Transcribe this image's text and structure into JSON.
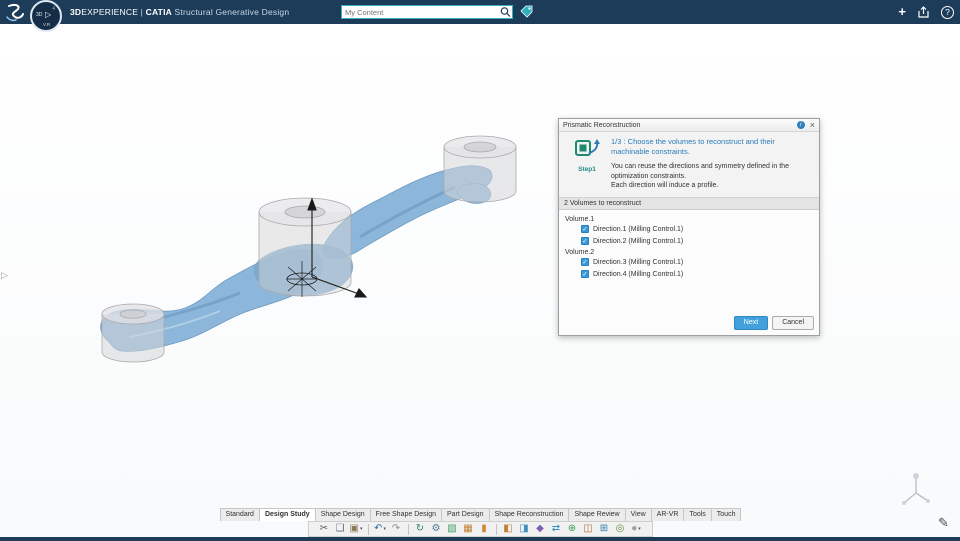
{
  "header": {
    "brand_bold": "3D",
    "brand_rest": "EXPERIENCE",
    "separator": "|",
    "app_bold": "CATIA",
    "app_rest": " Structural Generative Design",
    "search": {
      "placeholder": "My Content"
    },
    "compass": {
      "left": "3D",
      "play": "▷",
      "quad": "4",
      "bottom": "V.R"
    },
    "actions": {
      "add": "+",
      "help": "?"
    }
  },
  "viewport": {
    "panel_chevron": "▷",
    "pencil_glyph": "✎"
  },
  "dialog": {
    "title": "Prismatic Reconstruction",
    "info_glyph": "i",
    "close_glyph": "×",
    "step_label": "Step1",
    "step_text": "1/3 : Choose the volumes to reconstruct and their machinable constraints.",
    "body_line1": "You can reuse the directions and symmetry defined in the optimization constraints.",
    "body_line2": "Each direction will induce a profile.",
    "section": "2 Volumes to reconstruct",
    "volumes": [
      {
        "name": "Volume.1",
        "directions": [
          "Direction.1 (Milling Control.1)",
          "Direction.2 (Milling Control.1)"
        ]
      },
      {
        "name": "Volume.2",
        "directions": [
          "Direction.3 (Milling Control.1)",
          "Direction.4 (Milling Control.1)"
        ]
      }
    ],
    "next_label": "Next",
    "cancel_label": "Cancel",
    "accent_color": "#42a0dc",
    "checkbox_color": "#3a99d8"
  },
  "tabs": {
    "items": [
      "Standard",
      "Design Study",
      "Shape Design",
      "Free Shape Design",
      "Part Design",
      "Shape Reconstruction",
      "Shape Review",
      "View",
      "AR-VR",
      "Tools",
      "Touch"
    ],
    "active": "Design Study"
  },
  "toolbar": {
    "groups": [
      {
        "items": [
          {
            "name": "cut-icon",
            "glyph": "✂",
            "color": "#5a5a5a"
          },
          {
            "name": "copy-icon",
            "glyph": "❏",
            "color": "#5a6b7a"
          },
          {
            "name": "paste-icon",
            "glyph": "▣",
            "color": "#8a7a5a",
            "dropdown": true
          }
        ]
      },
      {
        "items": [
          {
            "name": "undo-icon",
            "glyph": "↶",
            "color": "#2b6ca3",
            "dropdown": true
          },
          {
            "name": "redo-icon",
            "glyph": "↷",
            "color": "#8a8f96"
          }
        ]
      },
      {
        "items": [
          {
            "name": "update-icon",
            "glyph": "↻",
            "color": "#2e8b57"
          },
          {
            "name": "settings-gear-icon",
            "glyph": "⚙",
            "color": "#4f7d8c"
          },
          {
            "name": "material-icon",
            "glyph": "▧",
            "color": "#3f9e6e"
          },
          {
            "name": "frame-icon",
            "glyph": "▦",
            "color": "#c07f33"
          },
          {
            "name": "column-icon",
            "glyph": "▮",
            "color": "#d08a3e"
          }
        ]
      },
      {
        "items": [
          {
            "name": "pad-icon",
            "glyph": "◧",
            "color": "#c07f33"
          },
          {
            "name": "pocket-icon",
            "glyph": "◨",
            "color": "#3f8fbf"
          },
          {
            "name": "shape-icon",
            "glyph": "◆",
            "color": "#7a5fb5"
          },
          {
            "name": "transform-icon",
            "glyph": "⇄",
            "color": "#2f8fbe"
          },
          {
            "name": "sweep-icon",
            "glyph": "⊕",
            "color": "#3f9e52"
          },
          {
            "name": "mirror-icon",
            "glyph": "◫",
            "color": "#b5713a"
          },
          {
            "name": "loft-icon",
            "glyph": "⊞",
            "color": "#2e7fae"
          },
          {
            "name": "revolve-icon",
            "glyph": "◎",
            "color": "#6a8f3f"
          },
          {
            "name": "view-mode-icon",
            "glyph": "●",
            "color": "#9aa0a6",
            "dropdown": true
          }
        ]
      }
    ]
  }
}
